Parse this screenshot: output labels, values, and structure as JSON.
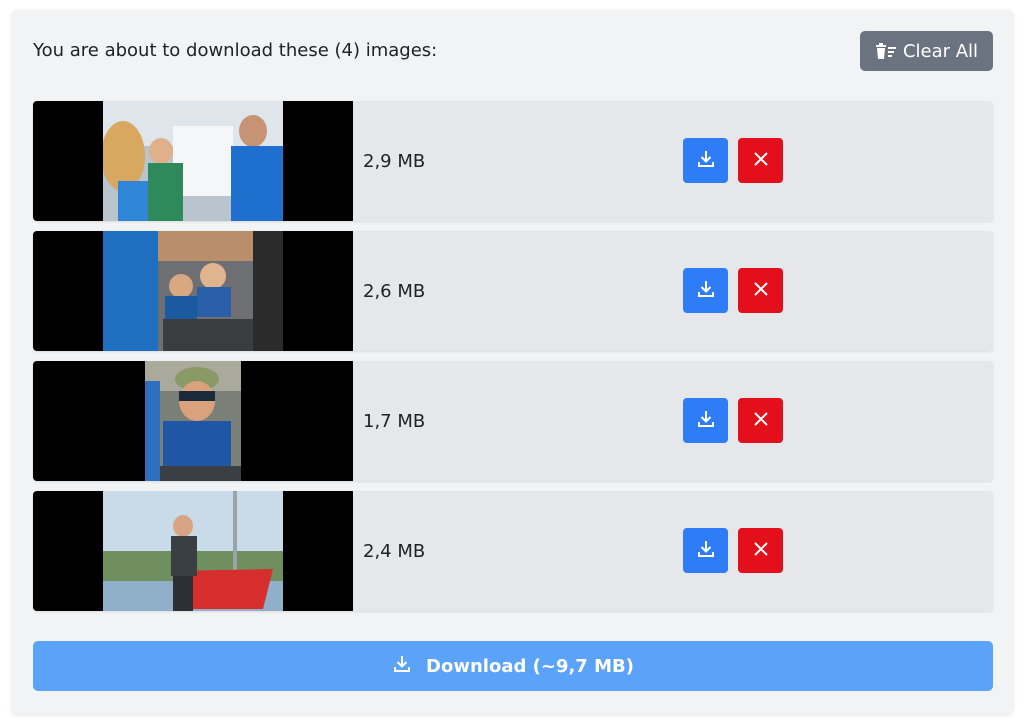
{
  "header": {
    "text": "You are about to download these (4) images:",
    "clear_label": "Clear All"
  },
  "items": [
    {
      "size": "2,9 MB"
    },
    {
      "size": "2,6 MB"
    },
    {
      "size": "1,7 MB"
    },
    {
      "size": "2,4 MB"
    }
  ],
  "download_all_label": "Download (~9,7 MB)",
  "colors": {
    "panel": "#f1f3f5",
    "clear_button": "#6b7280",
    "download_button": "#2f7df6",
    "remove_button": "#e3101c",
    "download_all": "#5ba3f9"
  },
  "icons": {
    "clear": "trash-list-icon",
    "download": "download-icon",
    "remove": "close-icon"
  }
}
